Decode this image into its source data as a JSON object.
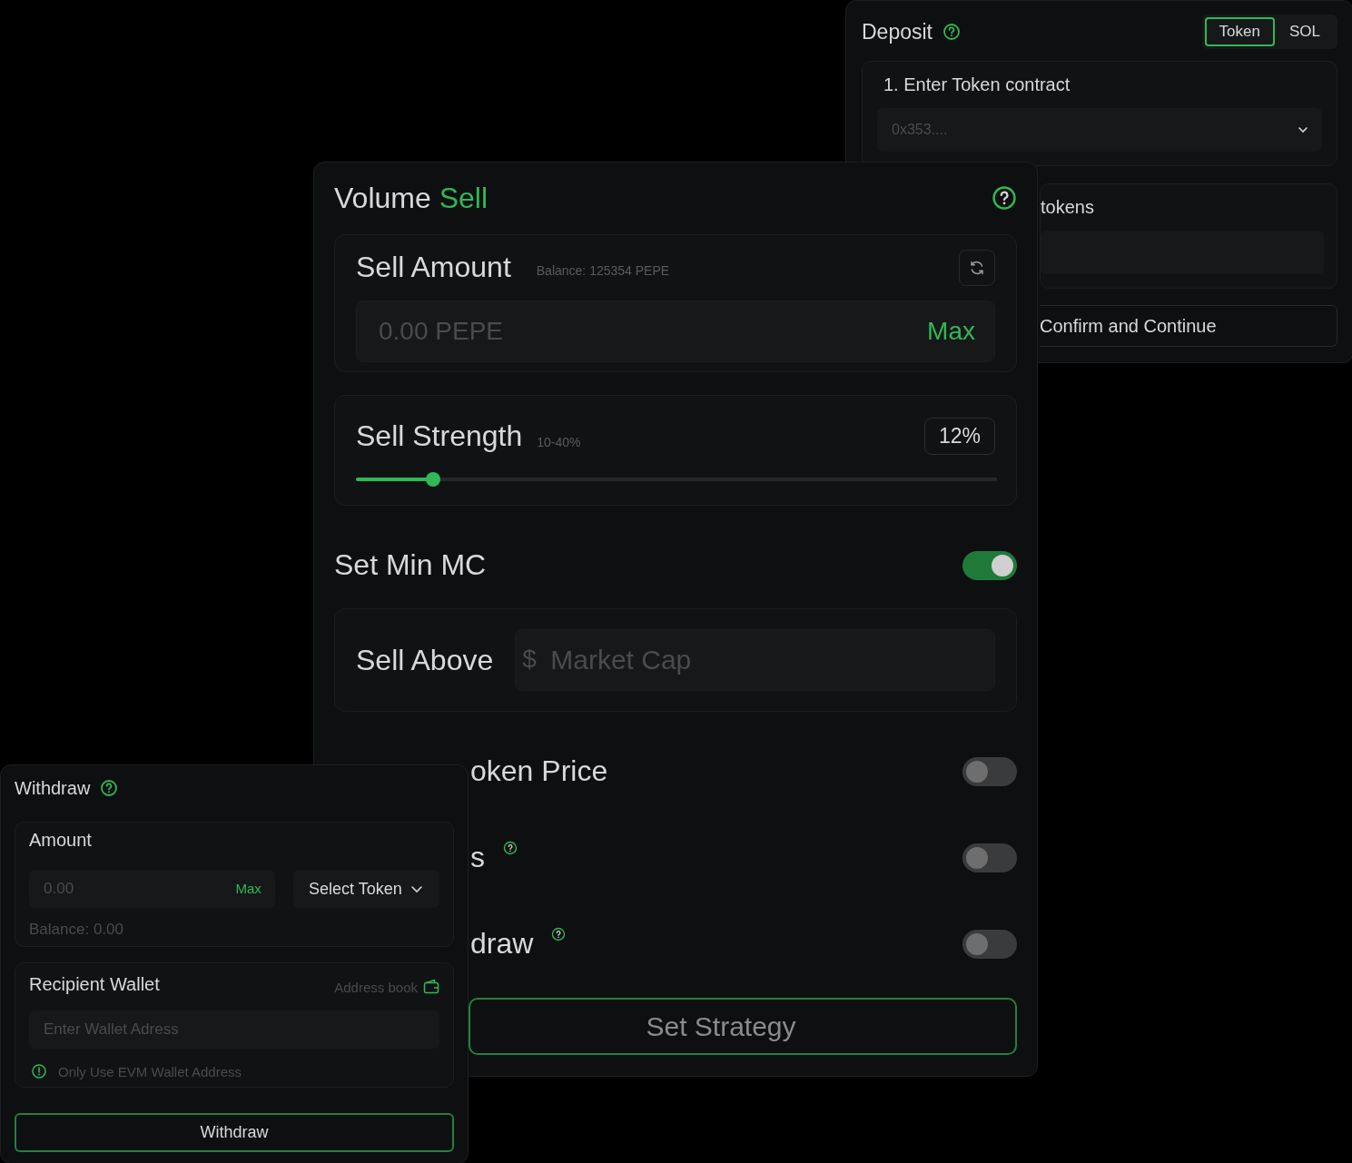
{
  "deposit": {
    "title": "Deposit",
    "tabs": [
      {
        "label": "Token",
        "selected": true
      },
      {
        "label": "SOL",
        "selected": false
      }
    ],
    "step_1": {
      "label": "1. Enter Token contract",
      "placeholder": "0x353...."
    },
    "step_2": {
      "label": "tokens"
    },
    "confirm_button": "Confirm and Continue"
  },
  "volume_sell": {
    "title": "Volume",
    "title_accent": "Sell",
    "sell_amount": {
      "label": "Sell Amount",
      "balance": "Balance: 125354 PEPE",
      "placeholder": "0.00 PEPE",
      "max": "Max"
    },
    "sell_strength": {
      "label": "Sell Strength",
      "range": "10-40%",
      "value": "12%",
      "level": 0.12
    },
    "toggles": [
      {
        "kind": "full",
        "label": "Set Min MC",
        "on": true,
        "help": false
      },
      {
        "kind": "cut",
        "label": "oken Price",
        "on": false,
        "help": false
      },
      {
        "kind": "cut",
        "label": "s",
        "on": false,
        "help": true
      },
      {
        "kind": "cut",
        "label": "draw",
        "on": false,
        "help": true
      }
    ],
    "sell_above": {
      "label": "Sell Above",
      "currency": "$",
      "placeholder": "Market Cap"
    },
    "set_strategy_button": "Set Strategy"
  },
  "withdraw": {
    "title": "Withdraw",
    "amount": {
      "label": "Amount",
      "placeholder": "0.00",
      "max": "Max",
      "token_select": "Select Token",
      "balance": "Balance: 0.00"
    },
    "recipient": {
      "label": "Recipient Wallet",
      "address_book": "Address book",
      "placeholder": "Enter Wallet Adress",
      "note": "Only Use EVM Wallet Address"
    },
    "withdraw_button": "Withdraw"
  }
}
